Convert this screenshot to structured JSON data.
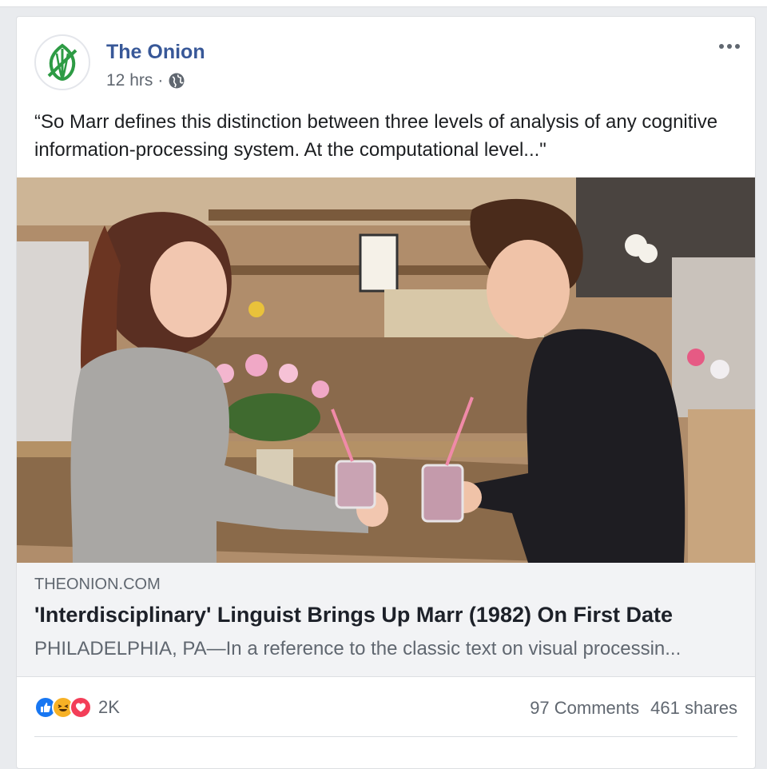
{
  "post": {
    "page_name": "The Onion",
    "time": "12 hrs",
    "separator": "·",
    "text": "“So Marr defines this distinction between three levels of analysis of any cognitive information-processing system. At the computational level...\""
  },
  "icons": {
    "avatar": "onion-logo",
    "audience": "globe-icon",
    "menu": "more-options-icon",
    "reactions": [
      "like-icon",
      "haha-icon",
      "love-icon"
    ]
  },
  "link": {
    "domain": "THEONION.COM",
    "title": "'Interdisciplinary' Linguist Brings Up Marr (1982) On First Date",
    "description": "PHILADELPHIA, PA—In a reference to the classic text on visual processin..."
  },
  "footer": {
    "reaction_count": "2K",
    "comments": "97 Comments",
    "shares": "461 shares"
  },
  "colors": {
    "brand_green": "#2d9b44",
    "link_blue": "#385898",
    "like": "#1877f2",
    "haha": "#f7b125",
    "love": "#f33e58"
  }
}
